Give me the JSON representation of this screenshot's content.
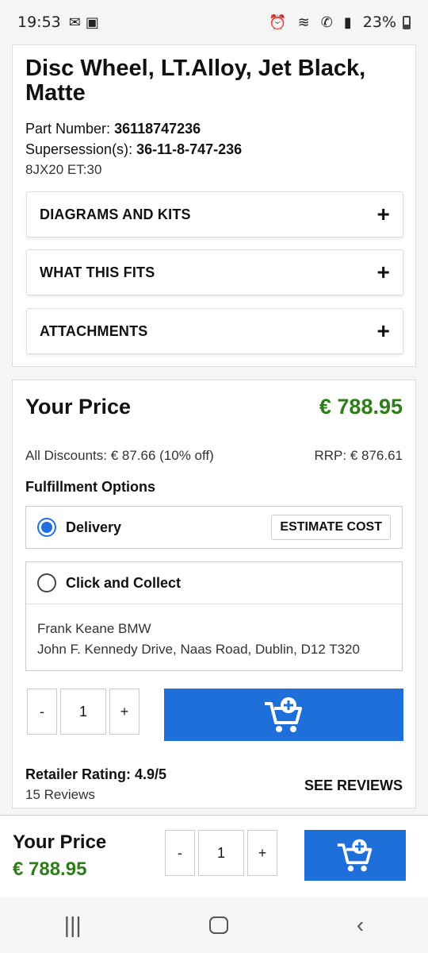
{
  "status": {
    "time": "19:53",
    "battery": "23%"
  },
  "product": {
    "title": "Disc Wheel, LT.Alloy, Jet Black, Matte",
    "part_label": "Part Number",
    "part_number": "36118747236",
    "super_label": "Supersession(s)",
    "supersession": "36-11-8-747-236",
    "spec": "8JX20 ET:30"
  },
  "accordions": [
    {
      "label": "DIAGRAMS AND KITS"
    },
    {
      "label": "WHAT THIS FITS"
    },
    {
      "label": "ATTACHMENTS"
    }
  ],
  "pricing": {
    "heading": "Your Price",
    "price": "€ 788.95",
    "discounts": "All Discounts: € 87.66 (10% off)",
    "rrp": "RRP: € 876.61",
    "fulfillment_heading": "Fulfillment Options",
    "delivery_label": "Delivery",
    "estimate_label": "ESTIMATE COST",
    "collect_label": "Click and Collect",
    "dealer_name": "Frank Keane BMW",
    "dealer_address": "John F. Kennedy Drive, Naas Road, Dublin, D12 T320",
    "minus": "-",
    "plus": "+",
    "quantity": "1"
  },
  "rating": {
    "label": "Retailer Rating: 4.9/5",
    "count": "15 Reviews",
    "see_reviews": "SEE REVIEWS"
  },
  "sticky": {
    "label": "Your Price",
    "price": "€ 788.95",
    "minus": "-",
    "plus": "+",
    "quantity": "1"
  },
  "colors": {
    "accent": "#1e6fd9",
    "price_green": "#2e7d18"
  }
}
